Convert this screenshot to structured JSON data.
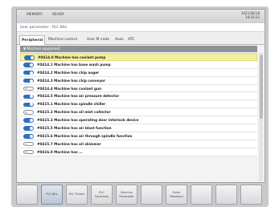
{
  "topbar": {
    "mode": "MEMORY",
    "status": "READY",
    "date": "2021/06/18",
    "time": "14:23:22"
  },
  "screen_title": "User parameter - PLC Bits",
  "tabs": [
    {
      "label": "Peripheral",
      "active": true
    },
    {
      "label": "Machine control",
      "active": false
    },
    {
      "label": "User M code",
      "active": false
    },
    {
      "label": "Axes",
      "active": false
    },
    {
      "label": "ATC",
      "active": false
    }
  ],
  "group_label": "Machine equipment",
  "params": [
    {
      "label": "#0414.0 Machine has coolant pump",
      "on": true,
      "selected": true
    },
    {
      "label": "#0414.1 Machine has base wash pump",
      "on": true,
      "selected": false
    },
    {
      "label": "#0414.2 Machine has chip auger",
      "on": true,
      "selected": false
    },
    {
      "label": "#0414.3 Machine has chip conveyor",
      "on": true,
      "selected": false
    },
    {
      "label": "#0414.4 Machine has coolant gun",
      "on": false,
      "selected": false
    },
    {
      "label": "#0414.5 Machine has air pressure detector",
      "on": true,
      "selected": false
    },
    {
      "label": "#0415.1 Machine has spindle chiller",
      "on": true,
      "selected": false
    },
    {
      "label": "#0415.2 Machine has oil mist collector",
      "on": false,
      "selected": false
    },
    {
      "label": "#0415.3 Machine has operating door interlock device",
      "on": true,
      "selected": false
    },
    {
      "label": "#0415.5 Machine has air blast function",
      "on": true,
      "selected": false
    },
    {
      "label": "#0415.6 Machine has air through spindle function",
      "on": true,
      "selected": false
    },
    {
      "label": "#0415.7 Machine has oil skimmer",
      "on": false,
      "selected": false
    },
    {
      "label": "#0416.0 Machine has ...",
      "on": false,
      "selected": false
    }
  ],
  "softkeys": [
    {
      "label": "",
      "active": false
    },
    {
      "label": "PLC Bits",
      "active": true
    },
    {
      "label": "PLC Timers",
      "active": false
    },
    {
      "label": "PLC Constants",
      "active": false
    },
    {
      "label": "Machine Parameter",
      "active": false
    },
    {
      "label": "",
      "active": false
    },
    {
      "label": "Enter Password",
      "active": false
    },
    {
      "label": "",
      "active": false
    },
    {
      "label": "",
      "active": false
    },
    {
      "label": "",
      "active": false
    }
  ],
  "icons": {
    "toggle_on": "toggle-on-icon",
    "toggle_off": "toggle-off-icon",
    "group": "chevron-down-icon"
  }
}
